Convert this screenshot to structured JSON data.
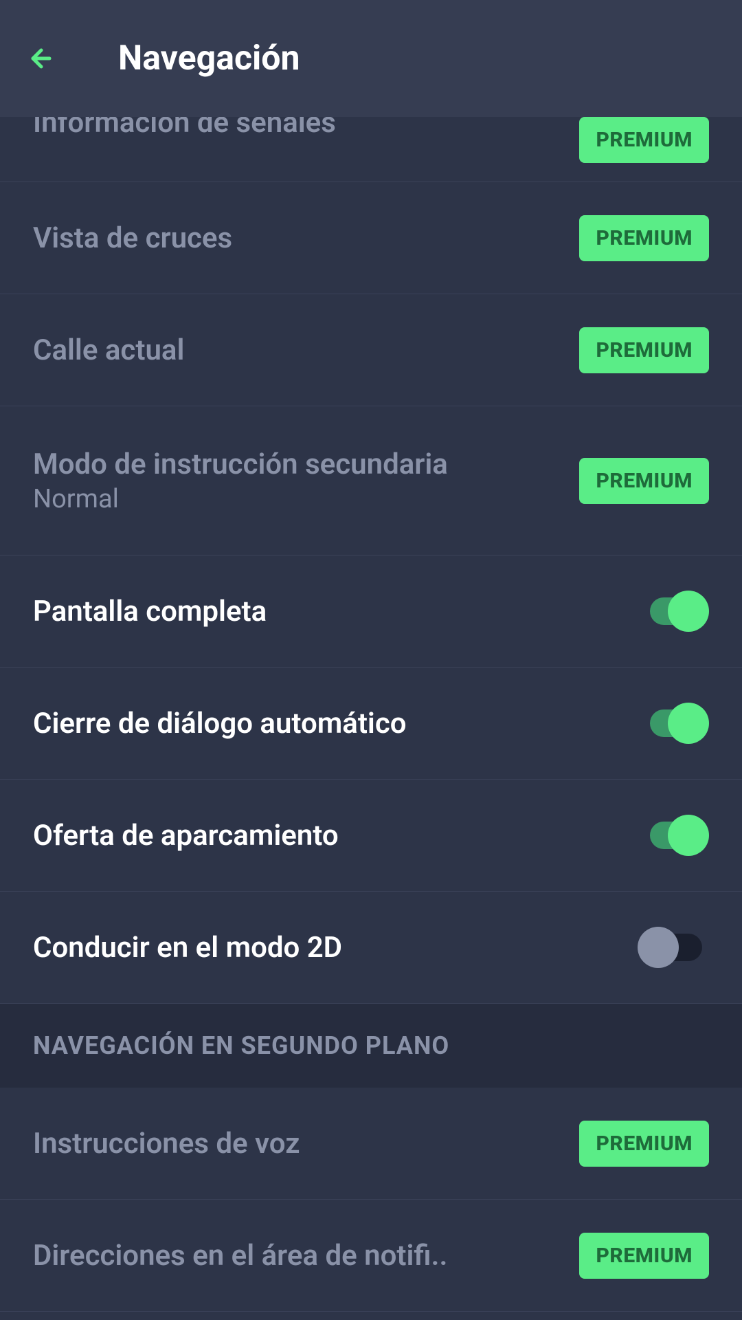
{
  "header": {
    "title": "Navegación"
  },
  "settings": [
    {
      "label": "Información de señales",
      "type": "premium",
      "badge": "PREMIUM",
      "partial": true
    },
    {
      "label": "Vista de cruces",
      "type": "premium",
      "badge": "PREMIUM"
    },
    {
      "label": "Calle actual",
      "type": "premium",
      "badge": "PREMIUM"
    },
    {
      "label": "Modo de instrucción secundaria",
      "sublabel": "Normal",
      "type": "premium",
      "badge": "PREMIUM",
      "tall": true
    },
    {
      "label": "Pantalla completa",
      "type": "toggle",
      "value": true
    },
    {
      "label": "Cierre de diálogo automático",
      "type": "toggle",
      "value": true
    },
    {
      "label": "Oferta de aparcamiento",
      "type": "toggle",
      "value": true
    },
    {
      "label": "Conducir en el modo 2D",
      "type": "toggle",
      "value": false
    }
  ],
  "section": {
    "title": "NAVEGACIÓN EN SEGUNDO PLANO"
  },
  "bgSettings": [
    {
      "label": "Instrucciones de voz",
      "type": "premium",
      "badge": "PREMIUM"
    },
    {
      "label": "Direcciones en el área de notifi..",
      "type": "premium",
      "badge": "PREMIUM",
      "truncate": true
    }
  ]
}
